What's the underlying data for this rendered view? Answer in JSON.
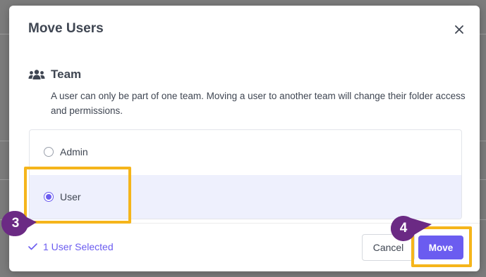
{
  "dialog": {
    "title": "Move Users",
    "close_icon": "close-icon"
  },
  "team_section": {
    "icon": "users-group-icon",
    "title": "Team",
    "description": "A user can only be part of one team. Moving a user to another team will change their folder access and permissions."
  },
  "roles": [
    {
      "label": "Admin",
      "selected": false
    },
    {
      "label": "User",
      "selected": true
    }
  ],
  "footer": {
    "check_icon": "check-icon",
    "selected_text": "1 User Selected",
    "cancel_label": "Cancel",
    "move_label": "Move"
  },
  "callouts": [
    {
      "number": "3",
      "target": "User option"
    },
    {
      "number": "4",
      "target": "Move button"
    }
  ],
  "colors": {
    "accent": "#6b5cf0",
    "selected_row": "#eef0fd",
    "callout_border": "#f5b51b",
    "badge": "#6b2a84",
    "text": "#3f4652"
  }
}
